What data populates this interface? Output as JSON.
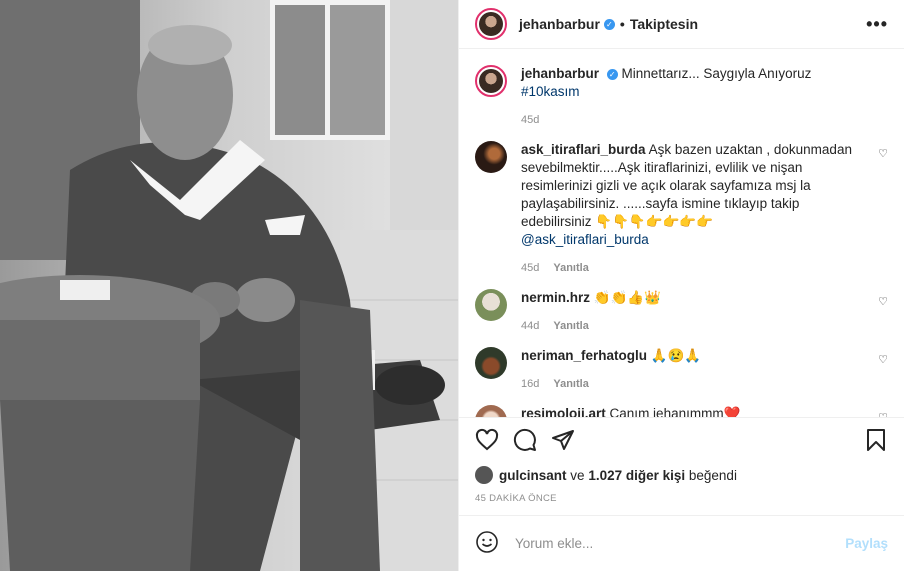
{
  "header": {
    "username": "jehanbarbur",
    "separator": "•",
    "follow_status": "Takiptesin",
    "more": "•••"
  },
  "caption": {
    "username": "jehanbarbur",
    "text": "Minnettarız... Saygıyla Anıyoruz ",
    "hashtag": "#10kasım",
    "age": "45d"
  },
  "comments": [
    {
      "username": "ask_itiraflari_burda",
      "text": "Aşk bazen uzaktan , dokunmadan sevebilmektir.....Aşk itiraflarinizi, evlilik ve nişan resimlerinizi gizli ve açık olarak sayfamıza msj la paylaşabilirsiniz. ......sayfa ismine tıklayıp takip edebilirsiniz 👇👇👇👉👉👉👉",
      "mention": "@ask_itiraflari_burda",
      "age": "45d",
      "reply": "Yanıtla"
    },
    {
      "username": "nermin.hrz",
      "text": "👏👏👍👑",
      "age": "44d",
      "reply": "Yanıtla"
    },
    {
      "username": "neriman_ferhatoglu",
      "text": "🙏😢🙏",
      "age": "16d",
      "reply": "Yanıtla"
    },
    {
      "username": "resimoloji.art",
      "text": "Canım jehanımmm❤️"
    }
  ],
  "likes": {
    "user": "gulcinsant",
    "and": "ve",
    "count": "1.027 diğer kişi",
    "suffix": "beğendi"
  },
  "timestamp": "45 DAKİKA ÖNCE",
  "add_comment": {
    "placeholder": "Yorum ekle...",
    "post": "Paylaş"
  },
  "icons": {
    "like": "heart-icon",
    "comment": "comment-icon",
    "share": "share-icon",
    "save": "bookmark-icon",
    "emoji": "emoji-icon",
    "verified": "verified-badge-icon"
  }
}
